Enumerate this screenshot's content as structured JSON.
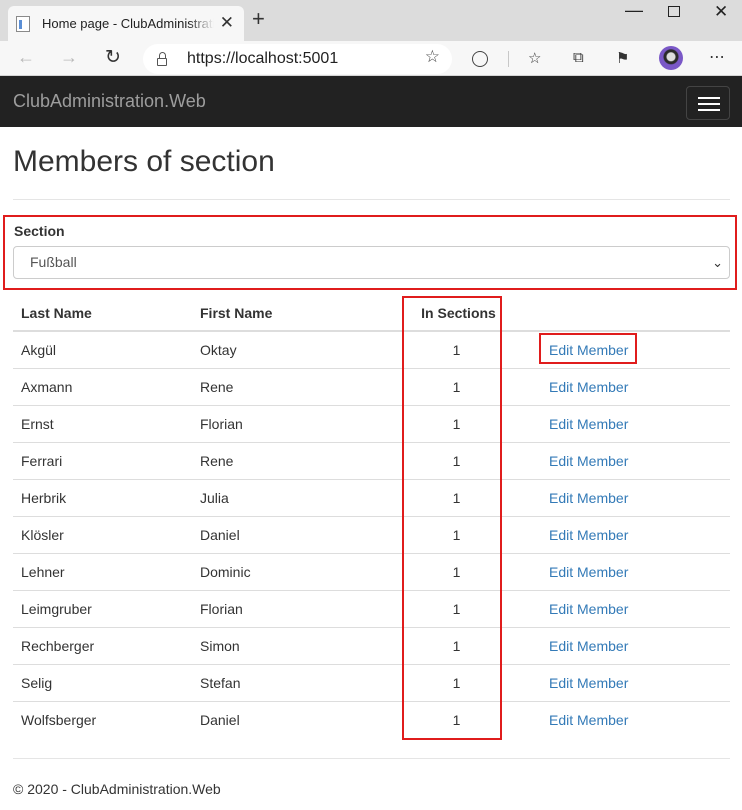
{
  "browser": {
    "tab_title": "Home page - ClubAdministration.Web",
    "url": "https://localhost:5001"
  },
  "navbar": {
    "brand": "ClubAdministration.Web"
  },
  "page": {
    "title": "Members of section",
    "section_label": "Section",
    "section_selected": "Fußball"
  },
  "table": {
    "headers": [
      "Last Name",
      "First Name",
      "In Sections",
      ""
    ],
    "edit_label": "Edit Member",
    "rows": [
      {
        "last": "Akgül",
        "first": "Oktay",
        "sections": "1"
      },
      {
        "last": "Axmann",
        "first": "Rene",
        "sections": "1"
      },
      {
        "last": "Ernst",
        "first": "Florian",
        "sections": "1"
      },
      {
        "last": "Ferrari",
        "first": "Rene",
        "sections": "1"
      },
      {
        "last": "Herbrik",
        "first": "Julia",
        "sections": "1"
      },
      {
        "last": "Klösler",
        "first": "Daniel",
        "sections": "1"
      },
      {
        "last": "Lehner",
        "first": "Dominic",
        "sections": "1"
      },
      {
        "last": "Leimgruber",
        "first": "Florian",
        "sections": "1"
      },
      {
        "last": "Rechberger",
        "first": "Simon",
        "sections": "1"
      },
      {
        "last": "Selig",
        "first": "Stefan",
        "sections": "1"
      },
      {
        "last": "Wolfsberger",
        "first": "Daniel",
        "sections": "1"
      }
    ]
  },
  "footer": {
    "text": "© 2020 - ClubAdministration.Web"
  },
  "colors": {
    "navbar_bg": "#222222",
    "link": "#337ab7",
    "highlight": "#e01c1c"
  }
}
